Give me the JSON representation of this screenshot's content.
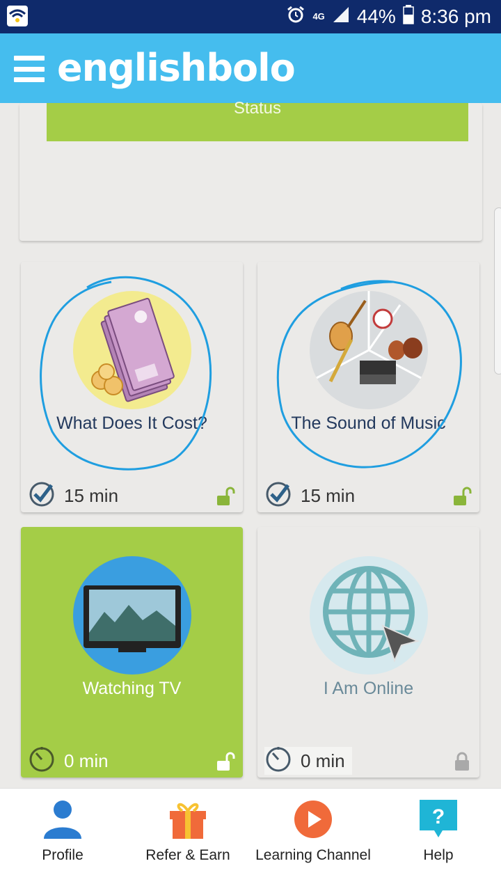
{
  "status_bar": {
    "network": "4G",
    "battery": "44%",
    "time": "8:36 pm"
  },
  "app": {
    "logo": "englishbolo"
  },
  "top_card": {
    "button_label": "Status"
  },
  "lessons": [
    {
      "title": "What Does It Cost?",
      "duration": "15 min",
      "locked": false,
      "circled": true
    },
    {
      "title": "The Sound of Music",
      "duration": "15 min",
      "locked": false,
      "circled": true
    },
    {
      "title": "Watching TV",
      "duration": "0 min",
      "locked": false,
      "active": true
    },
    {
      "title": "I Am Online",
      "duration": "0 min",
      "locked": true
    }
  ],
  "bottom_nav": [
    {
      "label": "Profile",
      "icon": "profile-icon"
    },
    {
      "label": "Refer & Earn",
      "icon": "gift-icon"
    },
    {
      "label": "Learning Channel",
      "icon": "play-icon"
    },
    {
      "label": "Help",
      "icon": "help-icon"
    }
  ],
  "colors": {
    "app_bar": "#45bdee",
    "status_bar": "#0f2a6b",
    "accent_green": "#a4cd47",
    "annotation_blue": "#1f9ee0"
  }
}
